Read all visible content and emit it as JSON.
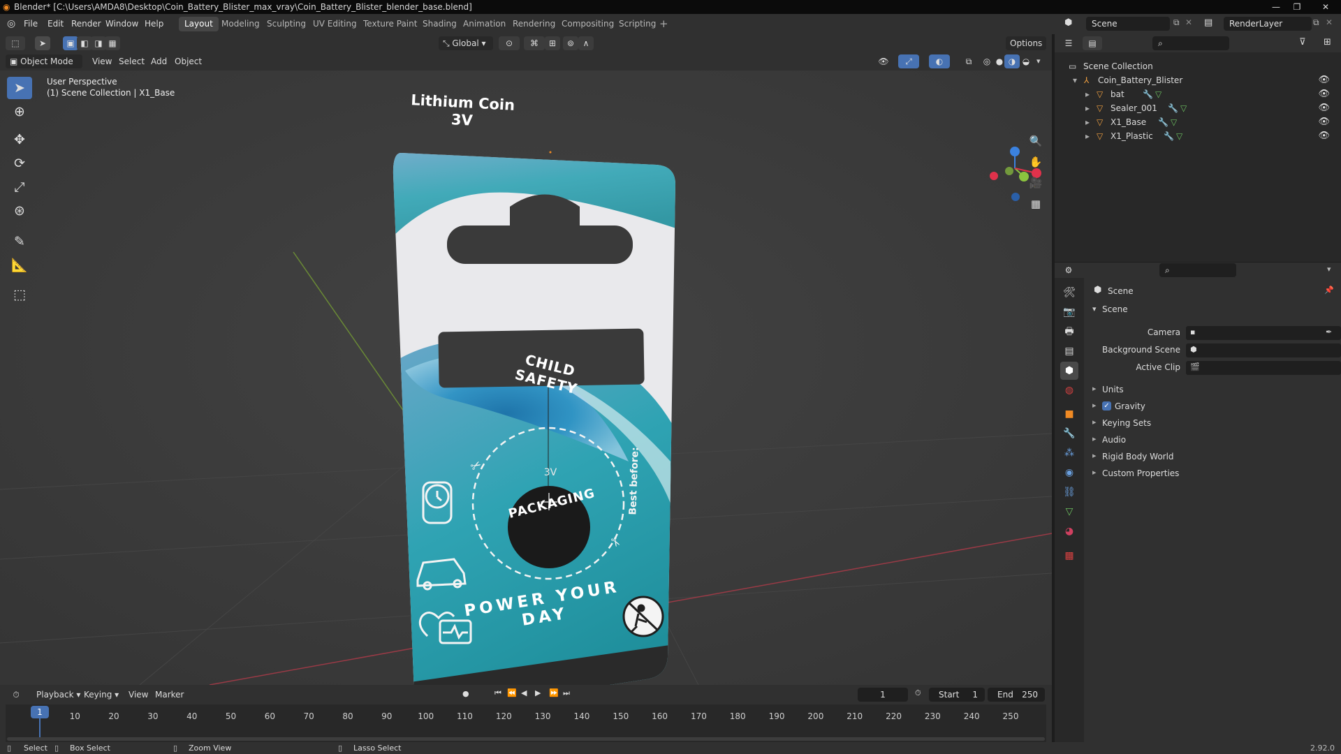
{
  "window": {
    "title": "Blender* [C:\\Users\\AMDA8\\Desktop\\Coin_Battery_Blister_max_vray\\Coin_Battery_Blister_blender_base.blend]",
    "controls": [
      "—",
      "❐",
      "✕"
    ]
  },
  "menubar": {
    "items": [
      "File",
      "Edit",
      "Render",
      "Window",
      "Help"
    ],
    "workspaces": [
      "Layout",
      "Modeling",
      "Sculpting",
      "UV Editing",
      "Texture Paint",
      "Shading",
      "Animation",
      "Rendering",
      "Compositing",
      "Scripting"
    ],
    "active_workspace": "Layout",
    "scene_name": "Scene",
    "view_layer": "RenderLayer"
  },
  "viewport_header": {
    "mode": "Object Mode",
    "menus": [
      "View",
      "Select",
      "Add",
      "Object"
    ],
    "transform_orientation": "Global",
    "options": "Options"
  },
  "viewport": {
    "perspective": "User Perspective",
    "collection_info": "(1) Scene Collection | X1_Base",
    "tools": [
      "select-box-tool",
      "cursor-tool",
      "move-tool",
      "rotate-tool",
      "scale-tool",
      "transform-tool",
      "annotate-tool",
      "measure-tool",
      "add-cube-tool"
    ],
    "gizmo": {
      "z": "Z",
      "y": "Y",
      "x": "X"
    }
  },
  "package": {
    "brand": "Lithium Coin",
    "voltage": "3V",
    "badge_top": "CHILD SAFETY",
    "badge_bottom": "PACKAGING",
    "coin_label": "3V",
    "side_text": "Best before:",
    "slogan": "POWER YOUR DAY"
  },
  "outliner": {
    "root": "Scene Collection",
    "collection": "Coin_Battery_Blister",
    "objects": [
      "bat",
      "Sealer_001",
      "X1_Base",
      "X1_Plastic"
    ]
  },
  "properties": {
    "context": "Scene",
    "panel": "Scene",
    "fields": [
      {
        "label": "Camera",
        "value": ""
      },
      {
        "label": "Background Scene",
        "value": ""
      },
      {
        "label": "Active Clip",
        "value": ""
      }
    ],
    "sections": [
      "Units",
      "Gravity",
      "Keying Sets",
      "Audio",
      "Rigid Body World",
      "Custom Properties"
    ],
    "gravity_enabled": true
  },
  "timeline": {
    "menus": [
      "Playback",
      "Keying",
      "View",
      "Marker"
    ],
    "current_frame": "1",
    "start_label": "Start",
    "start": "1",
    "end_label": "End",
    "end": "250",
    "ticks": [
      "1",
      "10",
      "20",
      "30",
      "40",
      "50",
      "60",
      "70",
      "80",
      "90",
      "100",
      "110",
      "120",
      "130",
      "140",
      "150",
      "160",
      "170",
      "180",
      "190",
      "200",
      "210",
      "220",
      "230",
      "240",
      "250"
    ]
  },
  "statusbar": {
    "select": "Select",
    "box_select": "Box Select",
    "zoom_view": "Zoom View",
    "lasso_select": "Lasso Select",
    "version": "2.92.0"
  },
  "colors": {
    "accent": "#4772b3",
    "x_axis": "#e0324b",
    "y_axis": "#8bc33f",
    "z_axis": "#3b82e0",
    "teal": "#2aa3b5"
  }
}
